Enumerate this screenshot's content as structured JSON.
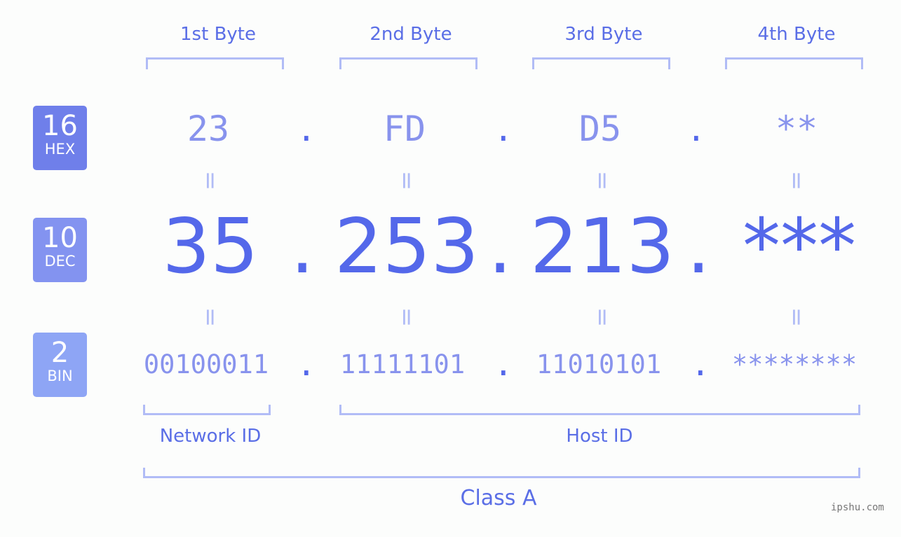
{
  "byte_headers": [
    "1st Byte",
    "2nd Byte",
    "3rd Byte",
    "4th Byte"
  ],
  "rows": {
    "hex": {
      "base": "16",
      "label": "HEX",
      "values": [
        "23",
        "FD",
        "D5",
        "**"
      ],
      "badge_color": "#6f7fea"
    },
    "dec": {
      "base": "10",
      "label": "DEC",
      "values": [
        "35",
        "253",
        "213",
        "***"
      ],
      "badge_color": "#8393f0"
    },
    "bin": {
      "base": "2",
      "label": "BIN",
      "values": [
        "00100011",
        "11111101",
        "11010101",
        "********"
      ],
      "badge_color": "#8ea5f5"
    }
  },
  "separator": ".",
  "equals": "=",
  "sections": {
    "network_id": "Network ID",
    "host_id": "Host ID",
    "class": "Class A"
  },
  "watermark": "ipshu.com",
  "colors": {
    "accent": "#5468ea",
    "muted": "#8893ed",
    "bracket": "#b1bcf6"
  }
}
